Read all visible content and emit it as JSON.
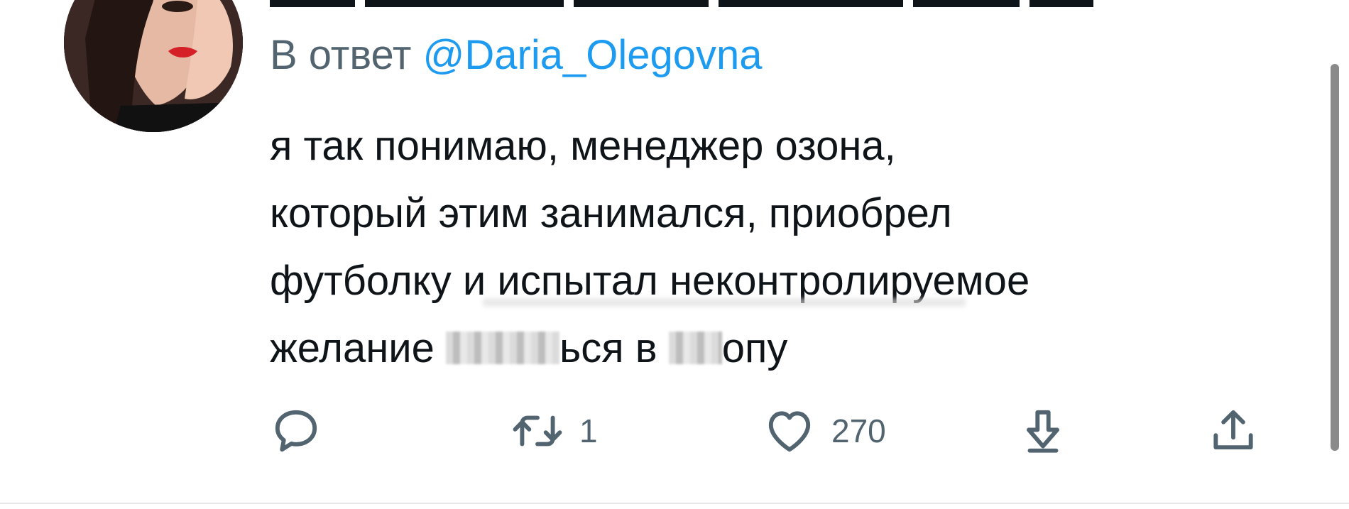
{
  "tweet": {
    "reply_prefix": "В ответ",
    "reply_handle": "@Daria_Olegovna",
    "text_lines": [
      [
        "я так понимаю, менеджер озона,"
      ],
      [
        "который этим занимался, приобрел"
      ],
      [
        "футболку и испытал неконтролируемое"
      ],
      [
        "желание ",
        "ься в ",
        "опу"
      ]
    ],
    "actions": {
      "reply": {
        "icon": "reply-icon"
      },
      "retweet": {
        "icon": "retweet-icon",
        "count": "1"
      },
      "like": {
        "icon": "heart-icon",
        "count": "270"
      },
      "bookmark": {
        "icon": "download-icon"
      },
      "share": {
        "icon": "share-icon"
      }
    }
  },
  "colors": {
    "text": "#0f1419",
    "secondary": "#536471",
    "link": "#1d9bf0"
  }
}
